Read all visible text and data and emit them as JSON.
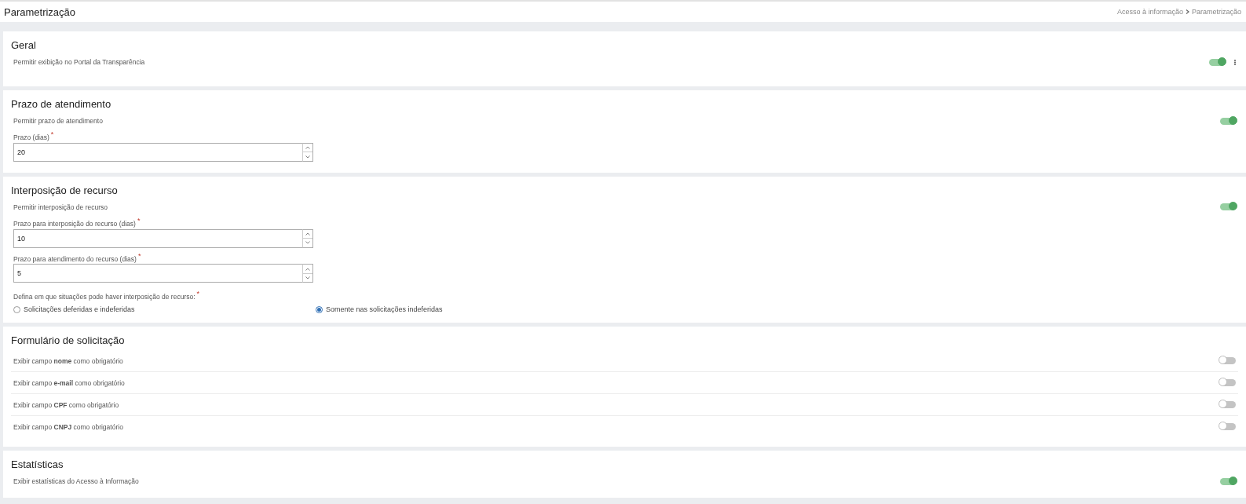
{
  "header": {
    "title": "Parametrização",
    "breadcrumb": [
      "Acesso à informação",
      "Parametrização"
    ]
  },
  "sections": [
    {
      "title": "Geral",
      "menu": true,
      "rows": [
        {
          "kind": "toggle",
          "label": "Permitir exibição no Portal da Transparência",
          "on": true
        }
      ]
    },
    {
      "title": "Prazo de atendimento",
      "rows": [
        {
          "kind": "toggle",
          "label": "Permitir prazo de atendimento",
          "on": true
        },
        {
          "kind": "number",
          "label": "Prazo (dias)",
          "required_mark": "*",
          "value": "20"
        }
      ]
    },
    {
      "title": "Interposição de recurso",
      "rows": [
        {
          "kind": "toggle",
          "label": "Permitir interposição de recurso",
          "on": true
        },
        {
          "kind": "number",
          "label": "Prazo para interposição do recurso (dias)",
          "required_mark": "*",
          "value": "10"
        },
        {
          "kind": "number",
          "label": "Prazo para atendimento do recurso (dias)",
          "required_mark": "*",
          "value": "5"
        },
        {
          "kind": "radio",
          "label": "Defina em que situações pode haver interposição de recurso:",
          "required_mark": "*",
          "options": [
            {
              "label": "Solicitações deferidas e indeferidas",
              "selected": false
            },
            {
              "label": "Somente nas solicitações indeferidas",
              "selected": true
            }
          ]
        }
      ]
    },
    {
      "title": "Formulário de solicitação",
      "divided": true,
      "rows": [
        {
          "kind": "toggle",
          "label": "Exibir campo **nome** como obrigatório",
          "on": false
        },
        {
          "kind": "toggle",
          "label": "Exibir campo **e-mail** como obrigatório",
          "on": false
        },
        {
          "kind": "toggle",
          "label": "Exibir campo **CPF** como obrigatório",
          "on": false
        },
        {
          "kind": "toggle",
          "label": "Exibir campo **CNPJ** como obrigatório",
          "on": false
        }
      ]
    },
    {
      "title": "Estatísticas",
      "rows": [
        {
          "kind": "toggle",
          "label": "Exibir estatísticas do Acesso à Informação",
          "on": true
        }
      ]
    }
  ]
}
